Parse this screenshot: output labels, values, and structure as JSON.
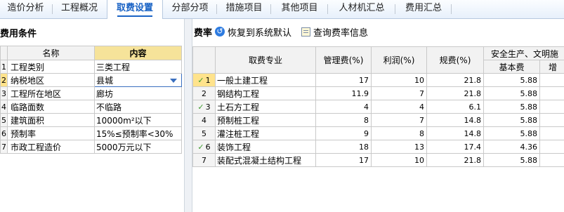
{
  "tabs": [
    "造价分析",
    "工程概况",
    "取费设置",
    "分部分项",
    "措施项目",
    "其他项目",
    "人材机汇总",
    "费用汇总"
  ],
  "left": {
    "title": "费用条件",
    "headers": [
      "名称",
      "内容"
    ],
    "rows": [
      {
        "num": "1",
        "name": "工程类别",
        "value": "三类工程"
      },
      {
        "num": "2",
        "name": "纳税地区",
        "value": "县城"
      },
      {
        "num": "3",
        "name": "工程所在地区",
        "value": "廊坊"
      },
      {
        "num": "4",
        "name": "临路面数",
        "value": "不临路"
      },
      {
        "num": "5",
        "name": "建筑面积",
        "value": "10000m²以下"
      },
      {
        "num": "6",
        "name": "预制率",
        "value": "15%≤预制率<30%"
      },
      {
        "num": "7",
        "name": "市政工程造价",
        "value": "5000万元以下"
      }
    ]
  },
  "right": {
    "label": "费率",
    "restore": "恢复到系统默认",
    "query": "查询费率信息",
    "headers": {
      "major": "取费专业",
      "mgmt": "管理费(%)",
      "profit": "利润(%)",
      "fees": "规费(%)",
      "safety": "安全生产、文明施",
      "base": "基本费",
      "extra": "增"
    },
    "rows": [
      {
        "num": "1",
        "check": true,
        "name": "一般土建工程",
        "mgmt": "17",
        "profit": "10",
        "fees": "21.8",
        "base": "5.88"
      },
      {
        "num": "2",
        "check": false,
        "name": "钢结构工程",
        "mgmt": "11.9",
        "profit": "7",
        "fees": "21.8",
        "base": "5.88"
      },
      {
        "num": "3",
        "check": true,
        "name": "土石方工程",
        "mgmt": "4",
        "profit": "4",
        "fees": "6.1",
        "base": "5.88"
      },
      {
        "num": "4",
        "check": false,
        "name": "预制桩工程",
        "mgmt": "8",
        "profit": "7",
        "fees": "14.8",
        "base": "5.88"
      },
      {
        "num": "5",
        "check": false,
        "name": "灌注桩工程",
        "mgmt": "9",
        "profit": "8",
        "fees": "14.8",
        "base": "5.88"
      },
      {
        "num": "6",
        "check": true,
        "name": "装饰工程",
        "mgmt": "18",
        "profit": "13",
        "fees": "17.4",
        "base": "4.36"
      },
      {
        "num": "7",
        "check": false,
        "name": "装配式混凝土结构工程",
        "mgmt": "17",
        "profit": "10",
        "fees": "21.8",
        "base": "5.88"
      }
    ]
  }
}
